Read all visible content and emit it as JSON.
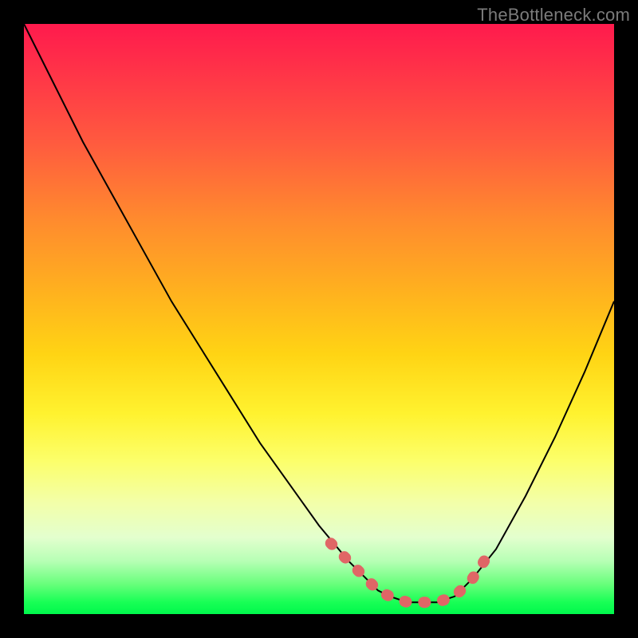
{
  "watermark": "TheBottleneck.com",
  "colors": {
    "frame": "#000000",
    "curve": "#000000",
    "highlight": "#e06666"
  },
  "chart_data": {
    "type": "line",
    "title": "",
    "xlabel": "",
    "ylabel": "",
    "xlim": [
      0,
      100
    ],
    "ylim": [
      0,
      100
    ],
    "grid": false,
    "legend": false,
    "series": [
      {
        "name": "bottleneck-curve",
        "x": [
          0,
          5,
          10,
          15,
          20,
          25,
          30,
          35,
          40,
          45,
          50,
          55,
          58,
          60,
          62,
          65,
          68,
          70,
          73,
          76,
          80,
          85,
          90,
          95,
          100
        ],
        "y": [
          100,
          90,
          80,
          71,
          62,
          53,
          45,
          37,
          29,
          22,
          15,
          9,
          6,
          4,
          3,
          2,
          2,
          2,
          3,
          6,
          11,
          20,
          30,
          41,
          53
        ]
      }
    ],
    "annotations": [
      {
        "name": "optimal-range-highlight",
        "type": "dotted-segment",
        "x": [
          52,
          55,
          58,
          60,
          62,
          65,
          68,
          70,
          73,
          76,
          78
        ],
        "y": [
          12,
          9,
          6,
          4,
          3,
          2,
          2,
          2,
          3,
          6,
          9
        ],
        "color": "#e06666"
      }
    ],
    "background_gradient": {
      "orientation": "vertical",
      "stops": [
        {
          "pos": 0.0,
          "color": "#ff1a4d"
        },
        {
          "pos": 0.2,
          "color": "#ff5a3f"
        },
        {
          "pos": 0.45,
          "color": "#ffb01f"
        },
        {
          "pos": 0.66,
          "color": "#fff22f"
        },
        {
          "pos": 0.87,
          "color": "#e3ffce"
        },
        {
          "pos": 1.0,
          "color": "#00f84c"
        }
      ]
    }
  }
}
